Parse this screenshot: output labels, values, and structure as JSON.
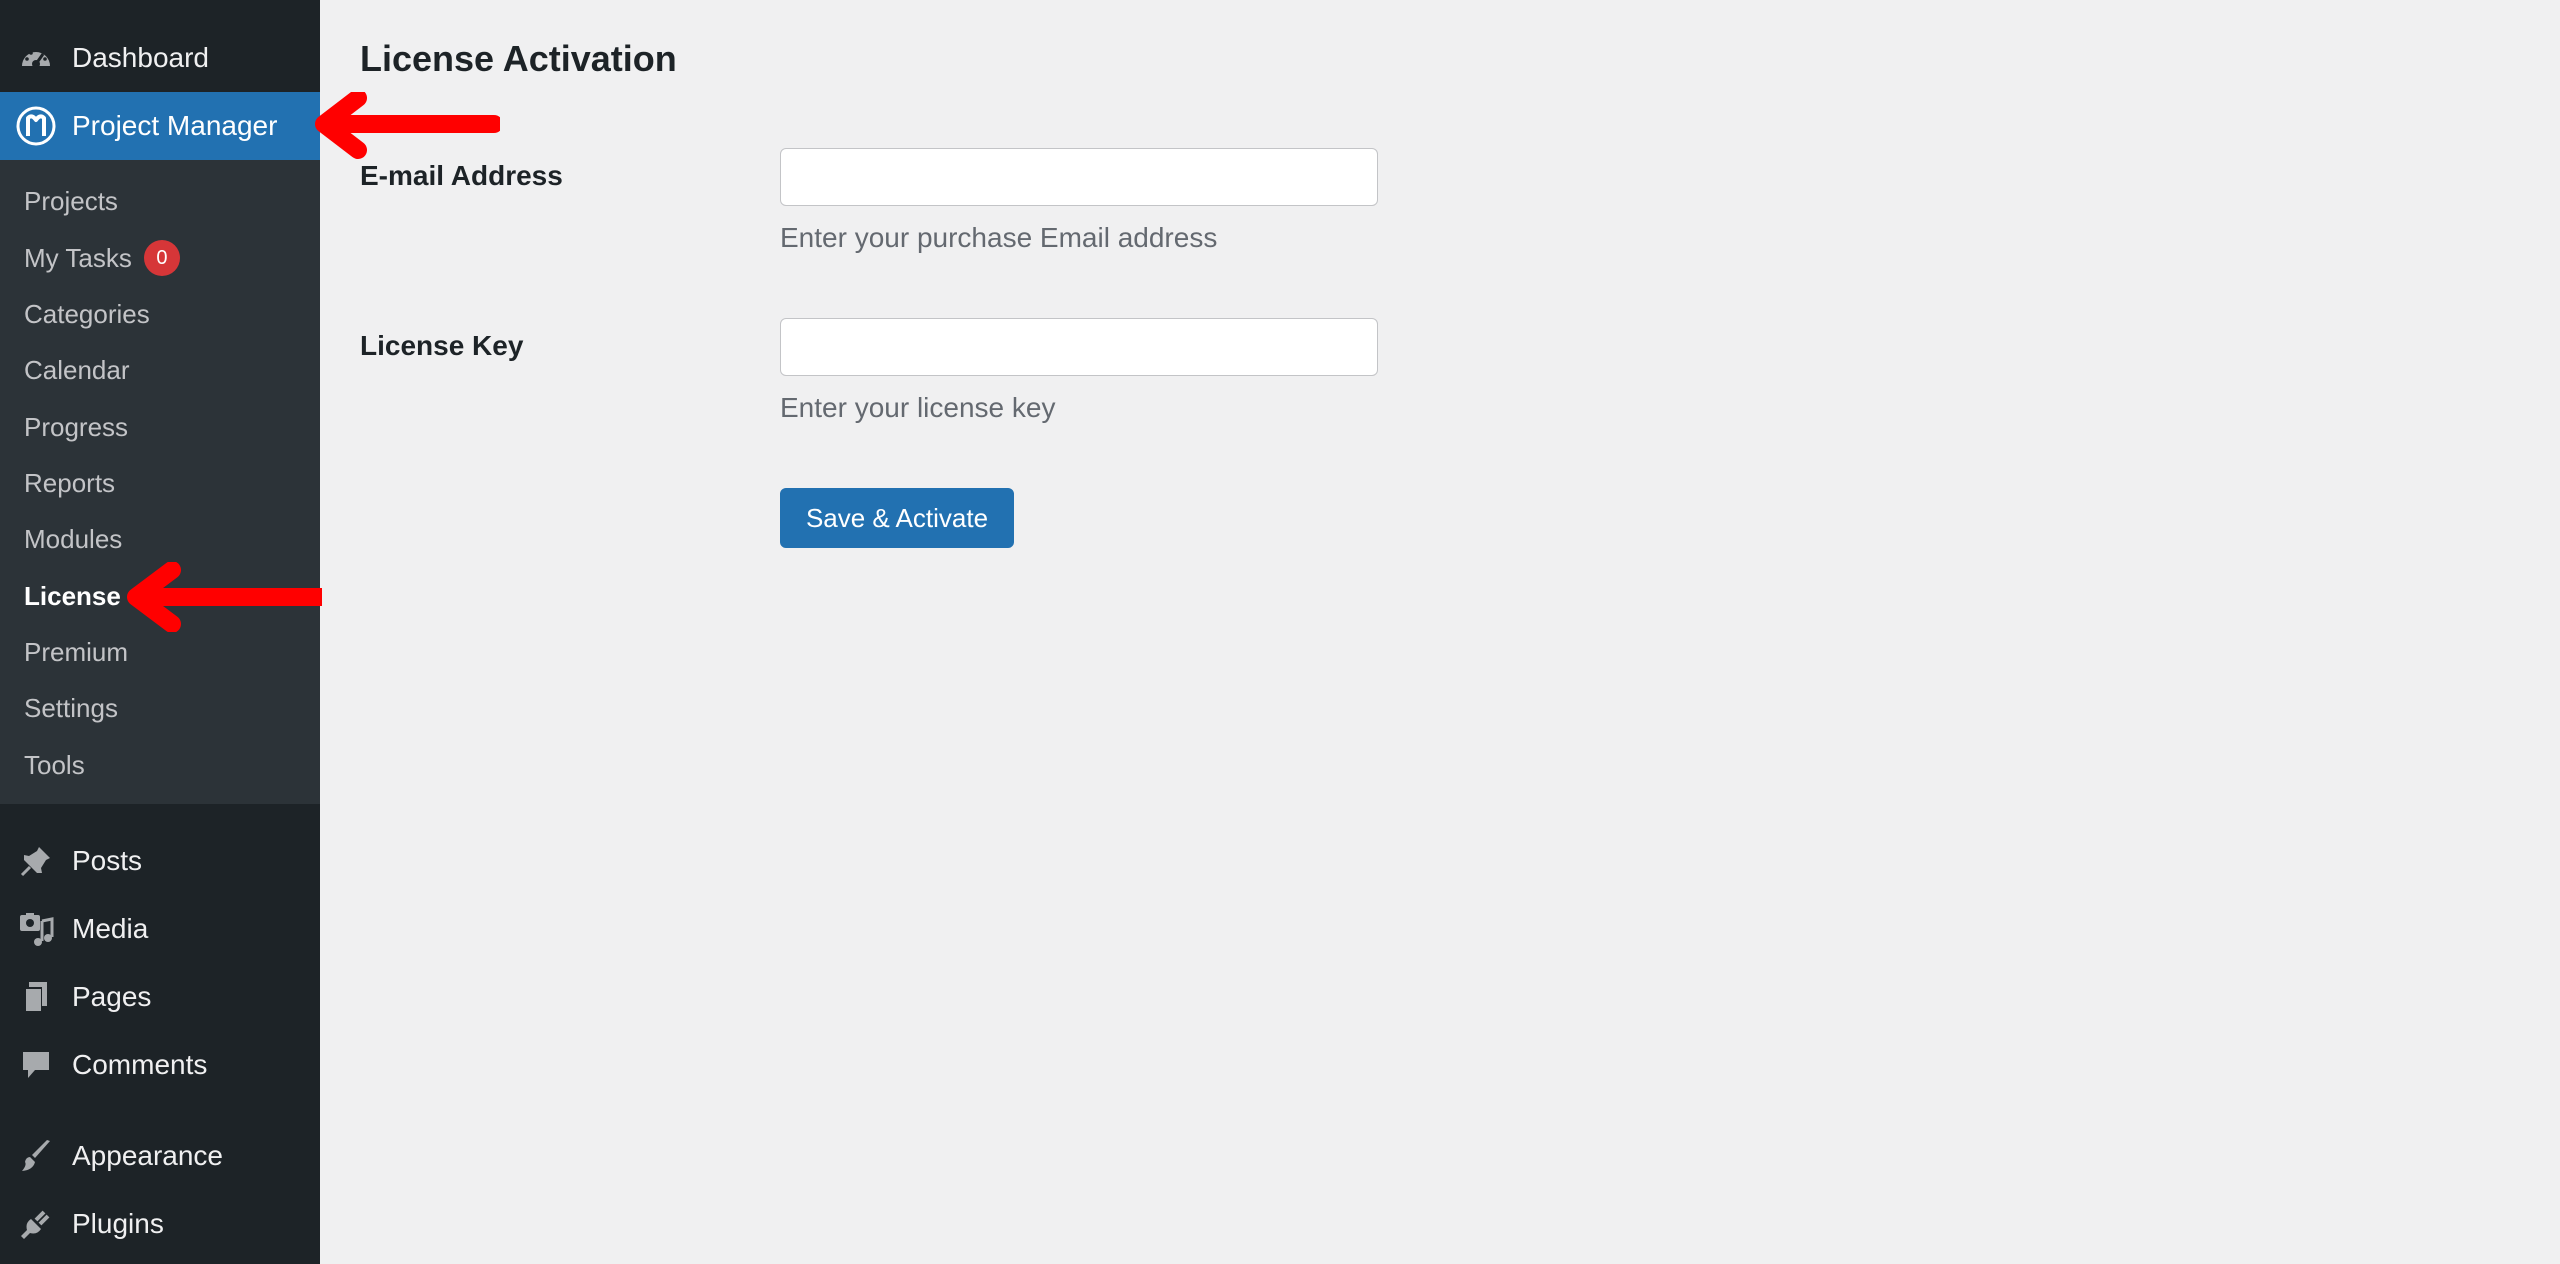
{
  "sidebar": {
    "dashboard_label": "Dashboard",
    "project_manager_label": "Project Manager",
    "submenu": {
      "projects": "Projects",
      "my_tasks": "My Tasks",
      "my_tasks_count": "0",
      "categories": "Categories",
      "calendar": "Calendar",
      "progress": "Progress",
      "reports": "Reports",
      "modules": "Modules",
      "license": "License",
      "premium": "Premium",
      "settings": "Settings",
      "tools": "Tools"
    },
    "posts_label": "Posts",
    "media_label": "Media",
    "pages_label": "Pages",
    "comments_label": "Comments",
    "appearance_label": "Appearance",
    "plugins_label": "Plugins",
    "icons": [
      "dashboard-icon",
      "project-manager-logo-icon",
      "pin-icon",
      "media-icon",
      "pages-icon",
      "comment-icon",
      "brush-icon",
      "plug-icon"
    ]
  },
  "main": {
    "title": "License Activation",
    "email": {
      "label": "E-mail Address",
      "value": "",
      "description": "Enter your purchase Email address"
    },
    "license_key": {
      "label": "License Key",
      "value": "",
      "description": "Enter your license key"
    },
    "submit_label": "Save & Activate"
  },
  "colors": {
    "sidebar_bg": "#1d2327",
    "submenu_bg": "#2c3338",
    "accent": "#2271b1",
    "badge": "#d63638",
    "annotation_arrow": "#ff0000"
  }
}
